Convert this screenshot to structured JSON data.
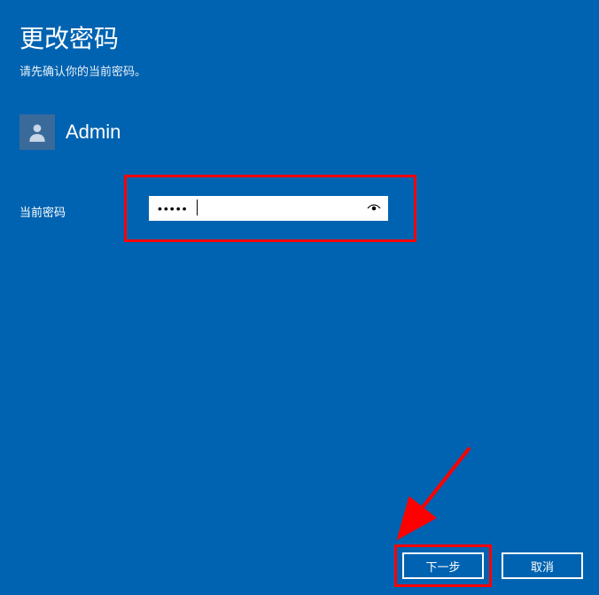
{
  "title": "更改密码",
  "subtitle": "请先确认你的当前密码。",
  "user": {
    "name": "Admin"
  },
  "password_field": {
    "label": "当前密码",
    "value": "•••••"
  },
  "buttons": {
    "next": "下一步",
    "cancel": "取消"
  },
  "colors": {
    "background": "#0063b1",
    "highlight": "#ff0000",
    "arrow": "#ff0000"
  }
}
